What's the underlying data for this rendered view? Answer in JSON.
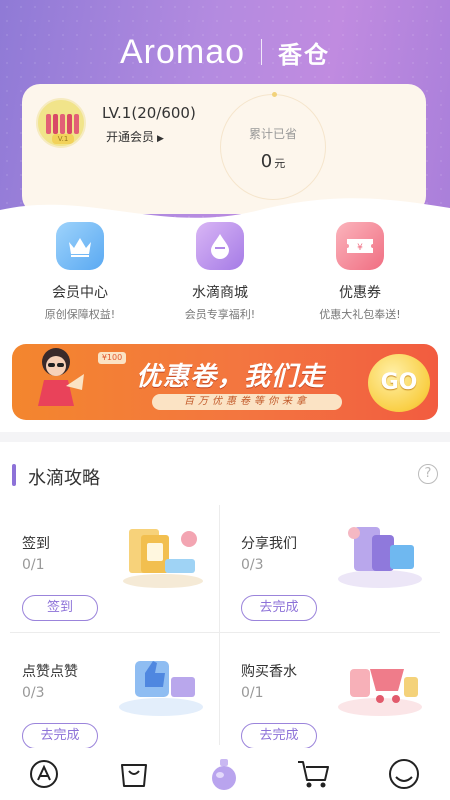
{
  "header": {
    "brand": "Aromao",
    "brand_cn": "香仓"
  },
  "member": {
    "avatar_tag": "V.1",
    "level": "LV.1(20/600)",
    "open_vip": "开通会员",
    "saved_label": "累计已省",
    "saved_value": "0",
    "saved_unit": "元"
  },
  "quick_links": [
    {
      "title": "会员中心",
      "subtitle": "原创保障权益!"
    },
    {
      "title": "水滴商城",
      "subtitle": "会员专享福利!"
    },
    {
      "title": "优惠券",
      "subtitle": "优惠大礼包奉送!"
    }
  ],
  "banner": {
    "title": "优惠卷，我们走",
    "subtitle": "百万优惠卷等你来拿",
    "go": "GO",
    "badge": "¥100"
  },
  "section": {
    "title": "水滴攻略",
    "help": "?"
  },
  "tasks": [
    {
      "name": "签到",
      "progress": "0/1",
      "button": "签到"
    },
    {
      "name": "分享我们",
      "progress": "0/3",
      "button": "去完成"
    },
    {
      "name": "点赞点赞",
      "progress": "0/3",
      "button": "去完成"
    },
    {
      "name": "购买香水",
      "progress": "0/1",
      "button": "去完成"
    }
  ],
  "tabbar": {
    "items": [
      "home-icon",
      "bag-icon",
      "perfume-icon",
      "cart-icon",
      "profile-icon"
    ],
    "active_color": "#b9a4ee",
    "icon_color": "#222222"
  },
  "colors": {
    "accent": "#8d72d8",
    "banner": "#f37540"
  }
}
